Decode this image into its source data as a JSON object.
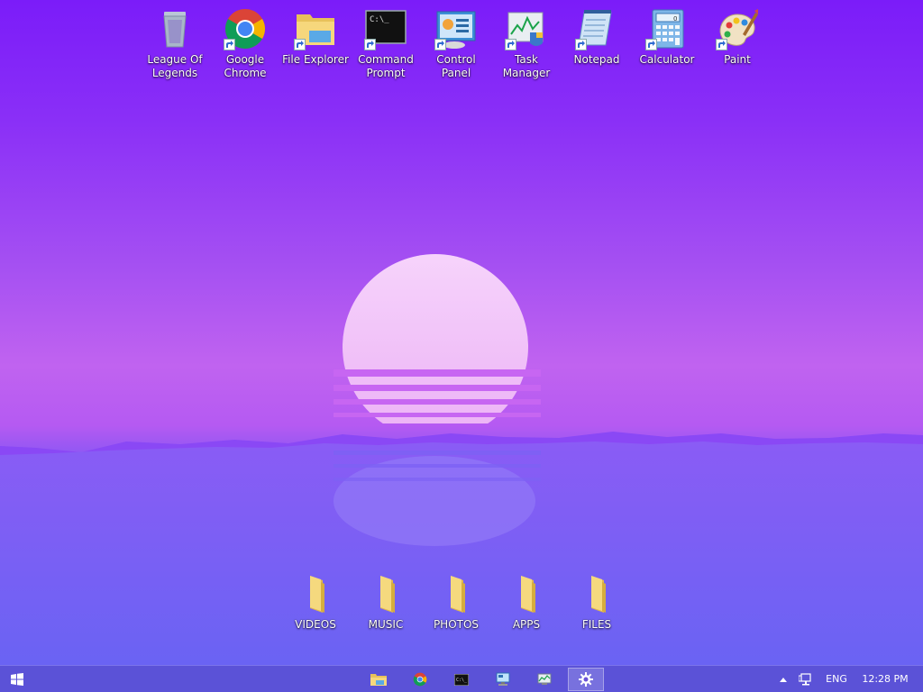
{
  "desktop_icons": [
    {
      "label": "League Of\nLegends",
      "icon": "recycle-bin-icon",
      "shortcut": false
    },
    {
      "label": "Google\nChrome",
      "icon": "chrome-icon",
      "shortcut": true
    },
    {
      "label": "File Explorer",
      "icon": "file-explorer-icon",
      "shortcut": true
    },
    {
      "label": "Command\nPrompt",
      "icon": "command-prompt-icon",
      "shortcut": true
    },
    {
      "label": "Control Panel",
      "icon": "control-panel-icon",
      "shortcut": true
    },
    {
      "label": "Task Manager",
      "icon": "task-manager-icon",
      "shortcut": true
    },
    {
      "label": "Notepad",
      "icon": "notepad-icon",
      "shortcut": true
    },
    {
      "label": "Calculator",
      "icon": "calculator-icon",
      "shortcut": true
    },
    {
      "label": "Paint",
      "icon": "paint-icon",
      "shortcut": true
    }
  ],
  "folders": [
    {
      "label": "VIDEOS"
    },
    {
      "label": "MUSIC"
    },
    {
      "label": "PHOTOS"
    },
    {
      "label": "APPS"
    },
    {
      "label": "FILES"
    }
  ],
  "taskbar": {
    "pinned": [
      {
        "icon": "file-explorer-icon",
        "active": false
      },
      {
        "icon": "chrome-icon",
        "active": false
      },
      {
        "icon": "command-prompt-icon",
        "active": false
      },
      {
        "icon": "remote-desktop-icon",
        "active": false
      },
      {
        "icon": "performance-monitor-icon",
        "active": false
      },
      {
        "icon": "settings-gear-icon",
        "active": true
      }
    ],
    "tray": {
      "language": "ENG",
      "time": "12:28 PM"
    }
  },
  "colors": {
    "taskbar": "#5b52d7",
    "sun": "#f3c6f9",
    "sky_top": "#7b1cf9"
  }
}
